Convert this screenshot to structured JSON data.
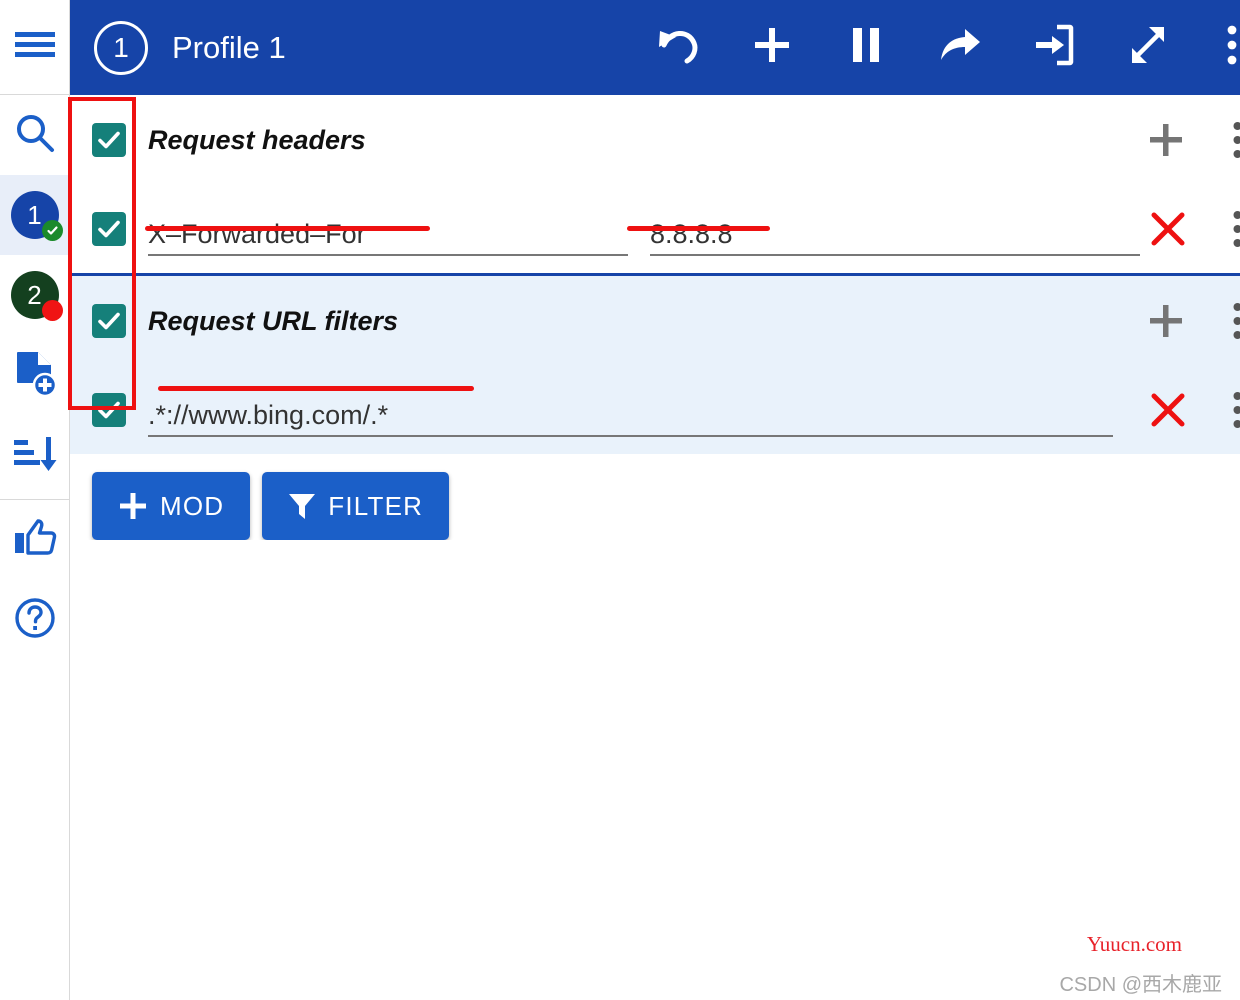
{
  "app": {
    "title": "Profile 1",
    "avatar_number": "1",
    "accent_blue": "#1644a8",
    "button_blue": "#1b5fc8",
    "checkbox_teal": "#15807a",
    "annotation_red": "#ee1111",
    "filter_section_bg": "#e9f2fb"
  },
  "rail": {
    "hamburger_label": "menu",
    "items": [
      {
        "name": "search",
        "icon": "search-icon",
        "label": ""
      },
      {
        "name": "profile-1",
        "icon": "profile-badge-icon",
        "label": "1",
        "selected": true,
        "badge": "check",
        "color": "#1644a8"
      },
      {
        "name": "profile-2",
        "icon": "profile-badge-icon",
        "label": "2",
        "selected": false,
        "badge": "dot",
        "color": "#14401f"
      },
      {
        "name": "new-profile",
        "icon": "file-add-icon",
        "label": ""
      },
      {
        "name": "sort",
        "icon": "sort-descending-icon",
        "label": ""
      },
      {
        "name": "thumbs-up",
        "icon": "thumbs-up-icon",
        "label": ""
      },
      {
        "name": "help",
        "icon": "help-circle-icon",
        "label": ""
      }
    ]
  },
  "toolbar": {
    "actions": [
      {
        "name": "undo",
        "icon": "undo-icon"
      },
      {
        "name": "add",
        "icon": "plus-icon"
      },
      {
        "name": "pause",
        "icon": "pause-icon"
      },
      {
        "name": "share",
        "icon": "share-arrow-icon"
      },
      {
        "name": "import",
        "icon": "login-icon"
      },
      {
        "name": "fullscreen",
        "icon": "expand-icon"
      },
      {
        "name": "more",
        "icon": "kebab-menu-icon"
      }
    ]
  },
  "sections": [
    {
      "id": "request-headers",
      "title": "Request headers",
      "enabled": true,
      "add_label": "+",
      "rows": [
        {
          "enabled": true,
          "name": "X–Forwarded–For",
          "value": "8.8.8.8"
        }
      ]
    },
    {
      "id": "request-url-filters",
      "title": "Request URL filters",
      "enabled": true,
      "add_label": "+",
      "rows": [
        {
          "enabled": true,
          "name": ".*://www.bing.com/.*",
          "value": ""
        }
      ]
    }
  ],
  "buttons": {
    "add_mod": "MOD",
    "add_filter": "FILTER"
  },
  "watermarks": {
    "red": "Yuucn.com",
    "gray": "CSDN @西木鹿亚"
  }
}
